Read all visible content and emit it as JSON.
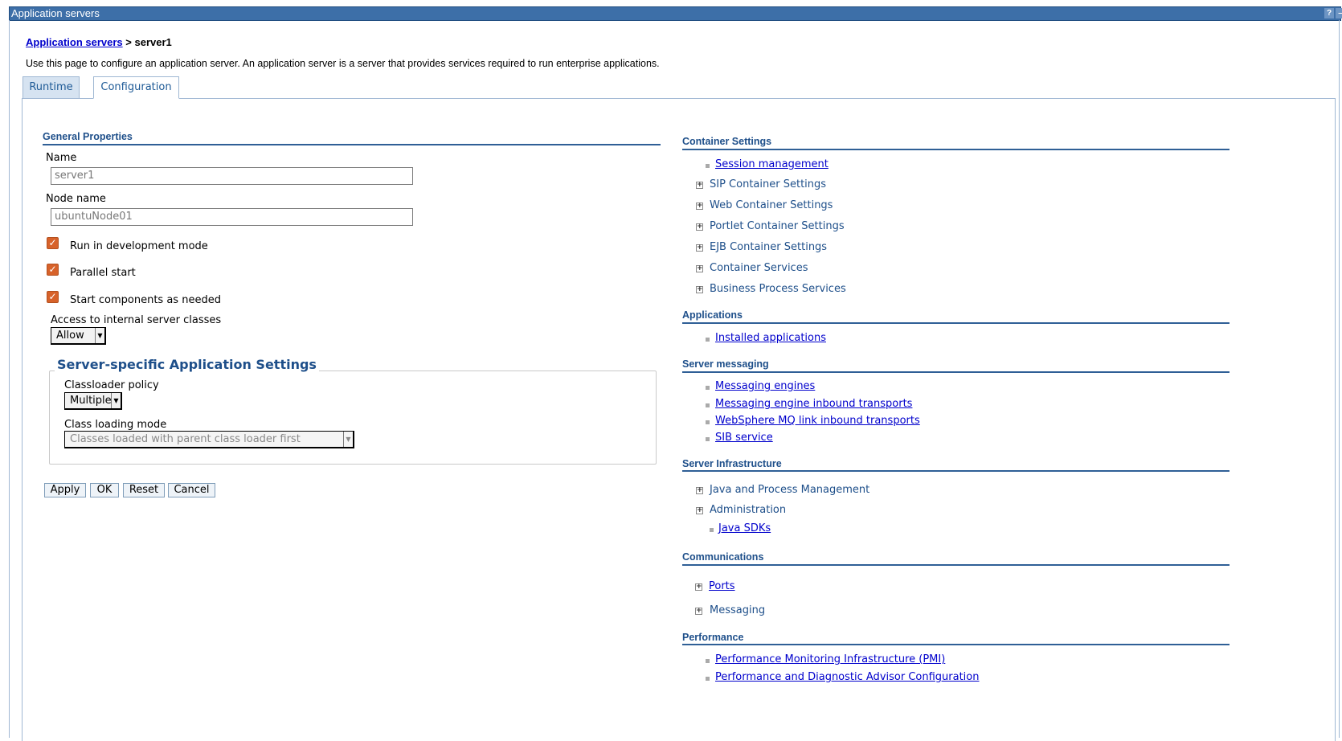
{
  "window": {
    "title": "Application servers",
    "help_glyph": "?",
    "minimize_glyph": "–"
  },
  "breadcrumb": {
    "parent": "Application servers",
    "separator": " > ",
    "current": "server1"
  },
  "description": "Use this page to configure an application server. An application server is a server that provides services required to run enterprise applications.",
  "tabs": {
    "runtime": "Runtime",
    "configuration": "Configuration"
  },
  "general": {
    "heading": "General Properties",
    "name_label": "Name",
    "name_value": "server1",
    "node_label": "Node name",
    "node_value": "ubuntuNode01",
    "dev_mode_label": "Run in development mode",
    "parallel_label": "Parallel start",
    "components_label": "Start components as needed",
    "access_label": "Access to internal server classes",
    "access_value": "Allow"
  },
  "server_specific": {
    "legend": "Server-specific Application Settings",
    "classloader_label": "Classloader policy",
    "classloader_value": "Multiple",
    "loading_mode_label": "Class loading mode",
    "loading_mode_value": "Classes loaded with parent class loader first"
  },
  "buttons": {
    "apply": "Apply",
    "ok": "OK",
    "reset": "Reset",
    "cancel": "Cancel"
  },
  "container_settings": {
    "heading": "Container Settings",
    "session": "Session management",
    "sip": "SIP Container Settings",
    "web": "Web Container Settings",
    "portlet": "Portlet Container Settings",
    "ejb": "EJB Container Settings",
    "services": "Container Services",
    "bps": "Business Process Services"
  },
  "applications": {
    "heading": "Applications",
    "installed": "Installed applications"
  },
  "server_messaging": {
    "heading": "Server messaging",
    "engines": "Messaging engines",
    "inbound": "Messaging engine inbound transports",
    "mq": "WebSphere MQ link inbound transports",
    "sib": "SIB service"
  },
  "server_infrastructure": {
    "heading": "Server Infrastructure",
    "java_process": "Java and Process Management",
    "administration": "Administration",
    "java_sdks": "Java SDKs"
  },
  "communications": {
    "heading": "Communications",
    "ports": "Ports",
    "messaging": "Messaging"
  },
  "performance": {
    "heading": "Performance",
    "pmi": "Performance Monitoring Infrastructure (PMI)",
    "pda": "Performance and Diagnostic Advisor Configuration"
  },
  "icons": {
    "checkbox": "checkmark-icon",
    "bullet": "square-bullet-icon",
    "expander": "plus-expand-icon"
  }
}
